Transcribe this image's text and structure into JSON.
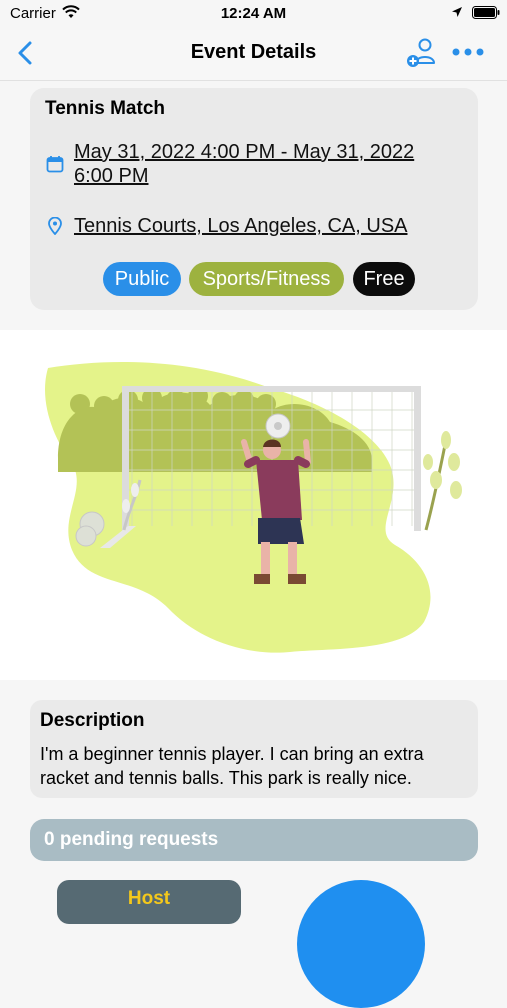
{
  "status_bar": {
    "carrier": "Carrier",
    "time": "12:24 AM"
  },
  "nav": {
    "title": "Event Details"
  },
  "event": {
    "title": "Tennis Match",
    "date_range": "May 31, 2022 4:00 PM - May 31, 2022 6:00 PM",
    "location": "Tennis Courts, Los Angeles, CA, USA",
    "tags": {
      "visibility": "Public",
      "category": "Sports/Fitness",
      "price": "Free"
    }
  },
  "description": {
    "heading": "Description",
    "text": "I'm a beginner tennis player. I can bring an extra racket and tennis balls. This park is really nice."
  },
  "requests": {
    "pending_label": "0 pending requests"
  },
  "actions": {
    "host_label": "Host"
  },
  "colors": {
    "accent": "#2a8fe8",
    "category": "#9db23f",
    "illustration": "#e4f38a",
    "pending": "#a9bcc4"
  },
  "icons": [
    "wifi-icon",
    "location-arrow-icon",
    "battery-icon",
    "back-chevron-icon",
    "add-person-icon",
    "more-dots-icon",
    "calendar-icon",
    "map-pin-icon"
  ]
}
